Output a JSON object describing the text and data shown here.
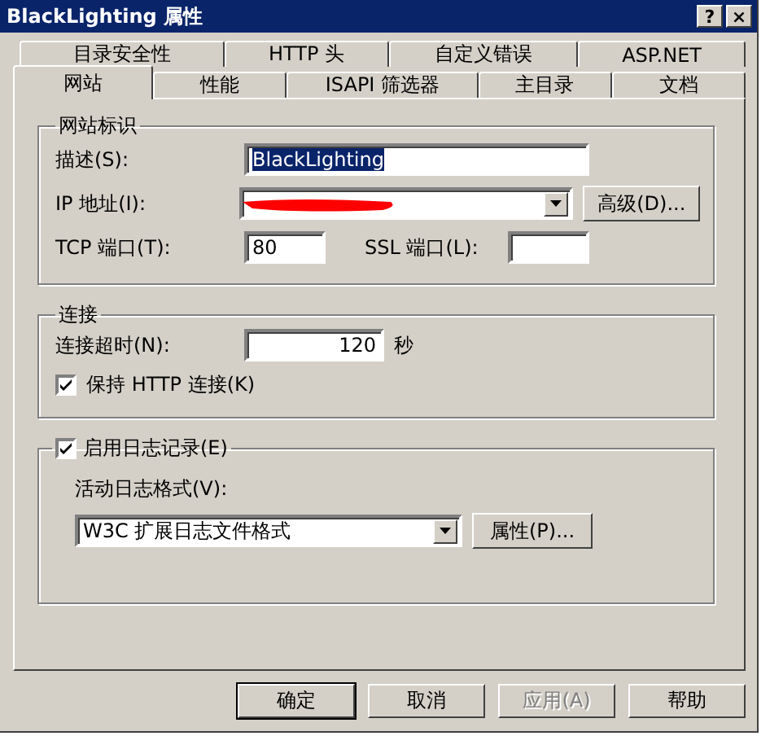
{
  "window": {
    "title": "BlackLighting 属性",
    "help_button": "?",
    "close_button": "×"
  },
  "tab_rows": [
    [
      {
        "label": "目录安全性",
        "selected": false
      },
      {
        "label": "HTTP 头",
        "selected": false
      },
      {
        "label": "自定义错误",
        "selected": false
      },
      {
        "label": "ASP.NET",
        "selected": false
      }
    ],
    [
      {
        "label": "网站",
        "selected": true
      },
      {
        "label": "性能",
        "selected": false
      },
      {
        "label": "ISAPI 筛选器",
        "selected": false
      },
      {
        "label": "主目录",
        "selected": false
      },
      {
        "label": "文档",
        "selected": false
      }
    ]
  ],
  "site_identity": {
    "title": "网站标识",
    "description_label": "描述(S):",
    "description_value": "BlackLighting",
    "ip_label": "IP 地址(I):",
    "ip_redacted": true,
    "advanced_button": "高级(D)...",
    "tcp_label": "TCP 端口(T):",
    "tcp_value": "80",
    "ssl_label": "SSL 端口(L):"
  },
  "connections": {
    "title": "连接",
    "timeout_label": "连接超时(N):",
    "timeout_value": "120",
    "timeout_unit": "秒",
    "keep_alive": {
      "label": "保持 HTTP 连接(K)",
      "checked": true
    }
  },
  "logging": {
    "enable": {
      "label": "启用日志记录(E)",
      "checked": true
    },
    "format_label": "活动日志格式(V):",
    "format_value": "W3C 扩展日志文件格式",
    "properties_button": "属性(P)..."
  },
  "buttons": [
    {
      "label": "确定",
      "disabled": false,
      "default": true
    },
    {
      "label": "取消",
      "disabled": false,
      "default": false
    },
    {
      "label": "应用(A)",
      "disabled": true,
      "default": false
    },
    {
      "label": "帮助",
      "disabled": false,
      "default": false
    }
  ]
}
